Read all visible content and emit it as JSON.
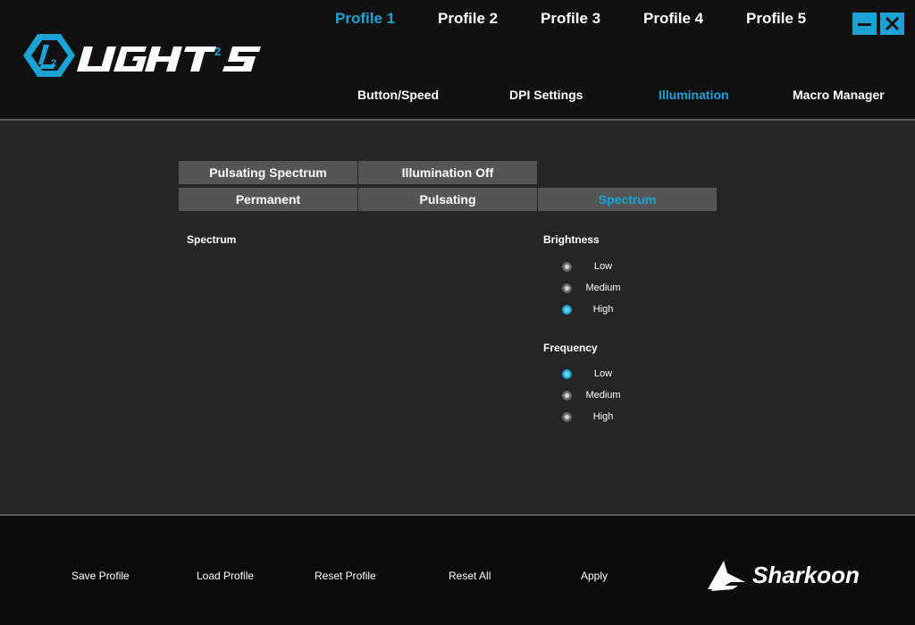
{
  "app": {
    "logo_text": "LIGHT²S",
    "brand_text": "Sharkoon"
  },
  "profiles": [
    {
      "label": "Profile 1",
      "active": true
    },
    {
      "label": "Profile 2",
      "active": false
    },
    {
      "label": "Profile 3",
      "active": false
    },
    {
      "label": "Profile 4",
      "active": false
    },
    {
      "label": "Profile 5",
      "active": false
    }
  ],
  "nav": [
    {
      "label": "Button/Speed",
      "active": false
    },
    {
      "label": "DPI Settings",
      "active": false
    },
    {
      "label": "Illumination",
      "active": true
    },
    {
      "label": "Macro Manager",
      "active": false
    }
  ],
  "modes": {
    "row1": [
      "Pulsating Spectrum",
      "Illumination Off"
    ],
    "row2": [
      "Permanent",
      "Pulsating",
      "Spectrum"
    ],
    "selected": "Spectrum"
  },
  "panel": {
    "title": "Spectrum"
  },
  "brightness": {
    "label": "Brightness",
    "options": [
      "Low",
      "Medium",
      "High"
    ],
    "selected": "High"
  },
  "frequency": {
    "label": "Frequency",
    "options": [
      "Low",
      "Medium",
      "High"
    ],
    "selected": "Low"
  },
  "footer": {
    "save": "Save Profile",
    "load": "Load Profile",
    "reset": "Reset Profile",
    "reset_all": "Reset All",
    "apply": "Apply"
  },
  "colors": {
    "accent": "#1ba3d6",
    "header_bg": "#111111",
    "content_bg": "#252525",
    "button_bg": "#555555"
  },
  "icons": {
    "minimize": "minimize-icon",
    "close": "close-icon"
  }
}
